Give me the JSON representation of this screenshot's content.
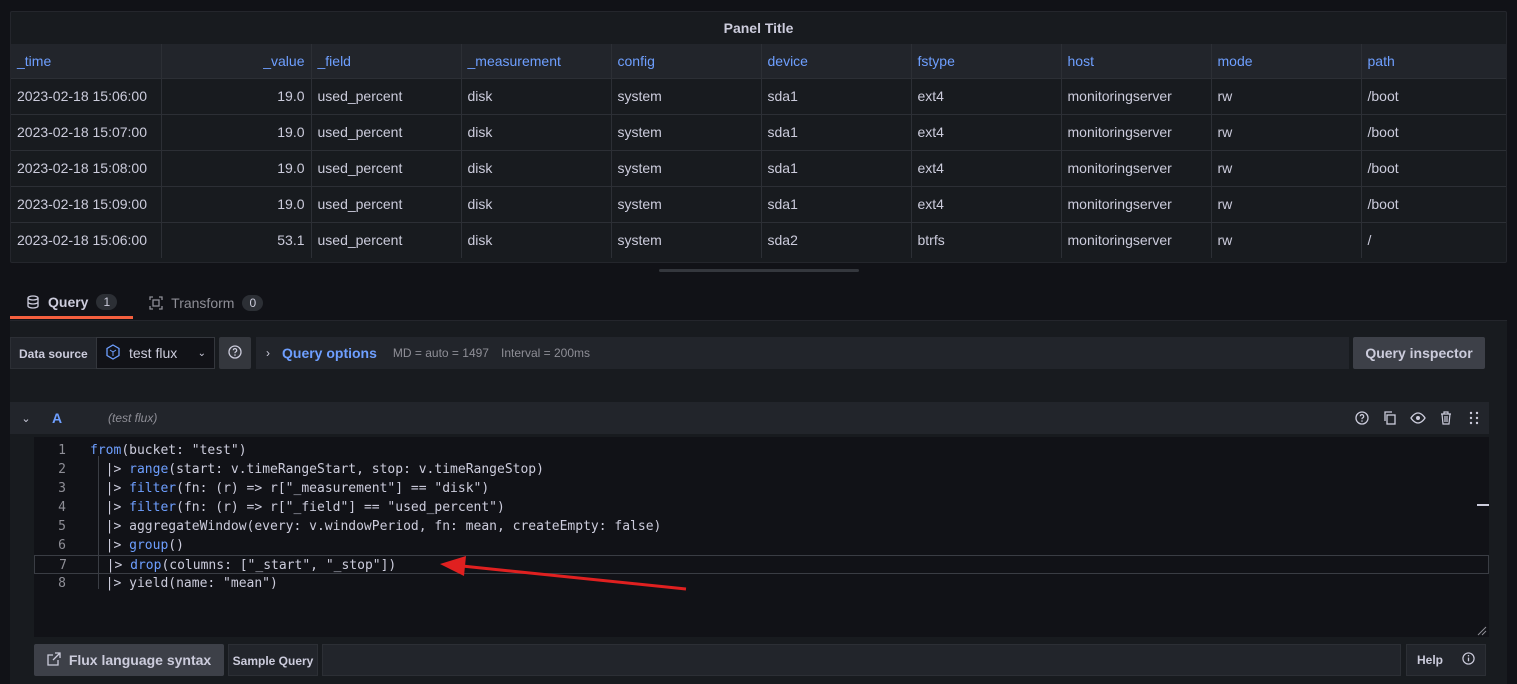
{
  "panel": {
    "title": "Panel Title"
  },
  "table": {
    "columns": [
      "_time",
      "_value",
      "_field",
      "_measurement",
      "config",
      "device",
      "fstype",
      "host",
      "mode",
      "path"
    ],
    "rows": [
      [
        "2023-02-18 15:06:00",
        "19.0",
        "used_percent",
        "disk",
        "system",
        "sda1",
        "ext4",
        "monitoringserver",
        "rw",
        "/boot"
      ],
      [
        "2023-02-18 15:07:00",
        "19.0",
        "used_percent",
        "disk",
        "system",
        "sda1",
        "ext4",
        "monitoringserver",
        "rw",
        "/boot"
      ],
      [
        "2023-02-18 15:08:00",
        "19.0",
        "used_percent",
        "disk",
        "system",
        "sda1",
        "ext4",
        "monitoringserver",
        "rw",
        "/boot"
      ],
      [
        "2023-02-18 15:09:00",
        "19.0",
        "used_percent",
        "disk",
        "system",
        "sda1",
        "ext4",
        "monitoringserver",
        "rw",
        "/boot"
      ],
      [
        "2023-02-18 15:06:00",
        "53.1",
        "used_percent",
        "disk",
        "system",
        "sda2",
        "btrfs",
        "monitoringserver",
        "rw",
        "/"
      ]
    ]
  },
  "tabs": [
    {
      "label": "Query",
      "count": "1",
      "icon": "database-icon"
    },
    {
      "label": "Transform",
      "count": "0",
      "icon": "transform-icon"
    }
  ],
  "datasource": {
    "label": "Data source",
    "selected": "test flux",
    "query_options_title": "Query options",
    "md": "MD = auto = 1497",
    "interval": "Interval = 200ms",
    "inspector_label": "Query inspector"
  },
  "query": {
    "ref_id": "A",
    "ds_name": "(test flux)",
    "lines": [
      "from(bucket: \"test\")",
      "  |> range(start: v.timeRangeStart, stop: v.timeRangeStop)",
      "  |> filter(fn: (r) => r[\"_measurement\"] == \"disk\")",
      "  |> filter(fn: (r) => r[\"_field\"] == \"used_percent\")",
      "  |> aggregateWindow(every: v.windowPeriod, fn: mean, createEmpty: false)",
      "  |> group()",
      "  |> drop(columns: [\"_start\", \"_stop\"])",
      "  |> yield(name: \"mean\")"
    ]
  },
  "footer": {
    "flux_syntax_label": "Flux language syntax",
    "sample_query_label": "Sample Query",
    "help_label": "Help"
  },
  "colors": {
    "accent": "#6e9fff",
    "active_tab": "#f55f3e",
    "annotation_arrow": "#e02020"
  }
}
